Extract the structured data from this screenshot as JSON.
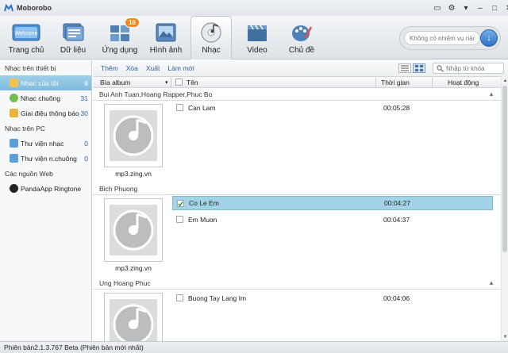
{
  "app": {
    "title": "Moborobo"
  },
  "toolbar": {
    "items": [
      {
        "label": "Trang chủ",
        "icon": "home-icon"
      },
      {
        "label": "Dữ liệu",
        "icon": "data-icon"
      },
      {
        "label": "Ứng dụng",
        "icon": "apps-icon",
        "badge": "16"
      },
      {
        "label": "Hình ảnh",
        "icon": "photos-icon"
      },
      {
        "label": "Nhạc",
        "icon": "music-disc-icon",
        "active": true
      },
      {
        "label": "Video",
        "icon": "video-clapper-icon"
      },
      {
        "label": "Chủ đề",
        "icon": "palette-icon"
      }
    ],
    "task_placeholder": "Không có nhiệm vụ nào",
    "welcome_label": "Welcome"
  },
  "sidebar": {
    "device_header": "Nhạc trên thiết bị",
    "device_items": [
      {
        "label": "Nhạc của tôi",
        "count": "8",
        "active": true
      },
      {
        "label": "Nhạc chuông",
        "count": "31"
      },
      {
        "label": "Giai điệu thông báo",
        "count": "30"
      }
    ],
    "pc_header": "Nhạc trên PC",
    "pc_items": [
      {
        "label": "Thư viện nhạc",
        "count": "0"
      },
      {
        "label": "Thư viện n.chuông",
        "count": "0"
      }
    ],
    "web_header": "Các nguồn Web",
    "web_items": [
      {
        "label": "PandaApp Ringtone"
      }
    ]
  },
  "actions": [
    "Thêm",
    "Xóa",
    "Xuất",
    "Làm mới"
  ],
  "search": {
    "placeholder": "Nhập từ khóa"
  },
  "columns": {
    "album": "Bìa album",
    "name": "Tên",
    "duration": "Thời gian",
    "activity": "Hoạt động"
  },
  "groups": [
    {
      "artist": "Bui Anh Tuan,Hoang Rapper,Phuc Bo",
      "album_caption": "mp3.zing.vn",
      "tracks": [
        {
          "name": "Can Lam",
          "duration": "00:05:28",
          "checked": false
        }
      ]
    },
    {
      "artist": "Bich Phuong",
      "album_caption": "mp3.zing.vn",
      "tracks": [
        {
          "name": "Co Le Em",
          "duration": "00:04:27",
          "checked": true,
          "selected": true
        },
        {
          "name": "Em Muon",
          "duration": "00:04:37",
          "checked": false
        }
      ]
    },
    {
      "artist": "Ung Hoang Phuc",
      "album_caption": "",
      "tracks": [
        {
          "name": "Buong Tay Lang Im",
          "duration": "00:04:06",
          "checked": false
        }
      ]
    }
  ],
  "status": {
    "text": "Phiên bản2.1.3.767 Beta  (Phiên bản mới nhất)"
  },
  "colors": {
    "accent": "#7dbbdd",
    "link": "#2a62a8",
    "badge": "#f08a1c"
  }
}
